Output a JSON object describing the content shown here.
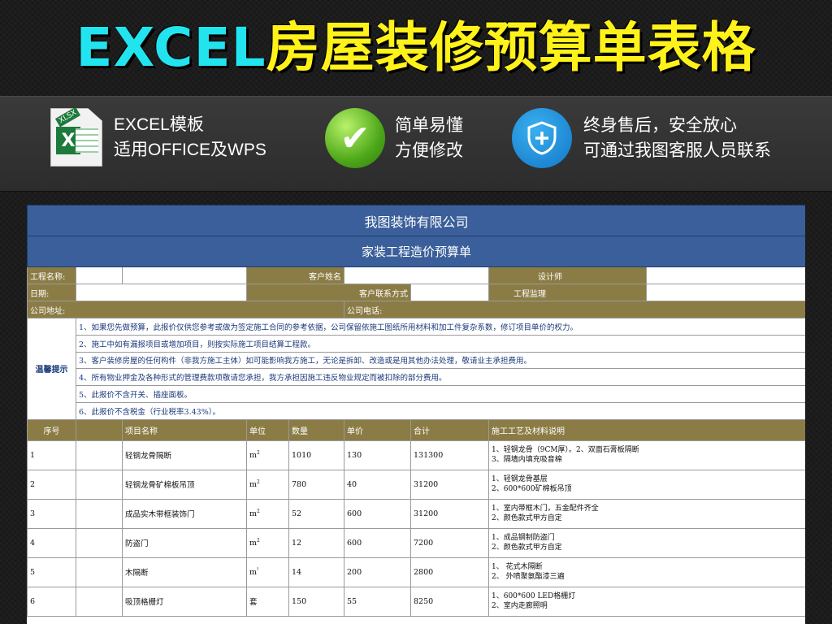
{
  "banner": {
    "title_latin": "EXCEL",
    "title_cjk": "房屋装修预算单表格"
  },
  "features": [
    {
      "icon": "xlsx-file-icon",
      "icon_tag": "XLSX",
      "line1": "EXCEL模板",
      "line2": "适用OFFICE及WPS"
    },
    {
      "icon": "check-icon",
      "line1": "简单易懂",
      "line2": "方便修改"
    },
    {
      "icon": "shield-plus-icon",
      "line1": "终身售后，安全放心",
      "line2": "可通过我图客服人员联系"
    }
  ],
  "sheet": {
    "company": "我图装饰有限公司",
    "doc_title": "家装工程造价预算单",
    "info": {
      "project_name": "工程名称:",
      "client_name": "客户姓名",
      "designer": "设计师",
      "date": "日期:",
      "client_contact": "客户联系方式",
      "supervisor": "工程监理",
      "company_address": "公司地址:",
      "company_phone": "公司电话:"
    },
    "tips_label": "温馨提示",
    "tips": [
      "1、如果您先做预算，此报价仅供您参考或做为签定施工合同的参考依据，公司保留依施工图纸所用材料和加工件复杂系数，修订项目单价的权力。",
      "2、施工中如有漏报项目或增加项目，则按实际施工项目结算工程款。",
      "3、客户装修房屋的任何构件（非我方施工主体）如可能影响我方施工，无论是拆卸、改造或是用其他办法处理，敬请业主承担费用。",
      "4、所有物业押金及各种形式的管理费款项敬请您承担，我方承担因施工违反物业规定而被扣除的部分费用。",
      "5、此报价不含开关、插座面板。",
      "6、此报价不含税金（行业税率3.43%）。"
    ],
    "columns": [
      "序号",
      "项目名称",
      "单位",
      "数量",
      "单价",
      "合计",
      "施工工艺及材料说明"
    ],
    "rows": [
      {
        "no": "1",
        "name": "轻钢龙骨隔断",
        "unit": "m",
        "unit_sup": "2",
        "qty": "1010",
        "price": "130",
        "total": "131300",
        "desc1": "1、轻钢龙骨（9CM厚）。2、双面石膏板隔断",
        "desc2": "3、隔墙内填充吸音棉"
      },
      {
        "no": "2",
        "name": "轻钢龙骨矿棉板吊顶",
        "unit": "m",
        "unit_sup": "2",
        "qty": "780",
        "price": "40",
        "total": "31200",
        "desc1": "1、轻钢龙骨基层",
        "desc2": "2、600*600矿棉板吊顶"
      },
      {
        "no": "3",
        "name": "成品实木带框装饰门",
        "unit": "m",
        "unit_sup": "2",
        "qty": "52",
        "price": "600",
        "total": "31200",
        "desc1": "1、室内带框木门，五金配件齐全",
        "desc2": "2、颜色款式甲方自定"
      },
      {
        "no": "4",
        "name": "防盗门",
        "unit": "m",
        "unit_sup": "2",
        "qty": "12",
        "price": "600",
        "total": "7200",
        "desc1": "1、成品钢制防盗门",
        "desc2": "2、颜色款式甲方自定"
      },
      {
        "no": "5",
        "name": "木隔断",
        "unit": "m",
        "unit_sup": "³",
        "qty": "14",
        "price": "200",
        "total": "2800",
        "desc1": "1、 花式木隔断",
        "desc2": "2、 外喷聚氨酯漆三遍"
      },
      {
        "no": "6",
        "name": "吸顶格栅灯",
        "unit": "套",
        "unit_sup": "",
        "qty": "150",
        "price": "55",
        "total": "8250",
        "desc1": "1、600*600 LED格栅灯",
        "desc2": "2、室内走廊照明"
      }
    ]
  }
}
